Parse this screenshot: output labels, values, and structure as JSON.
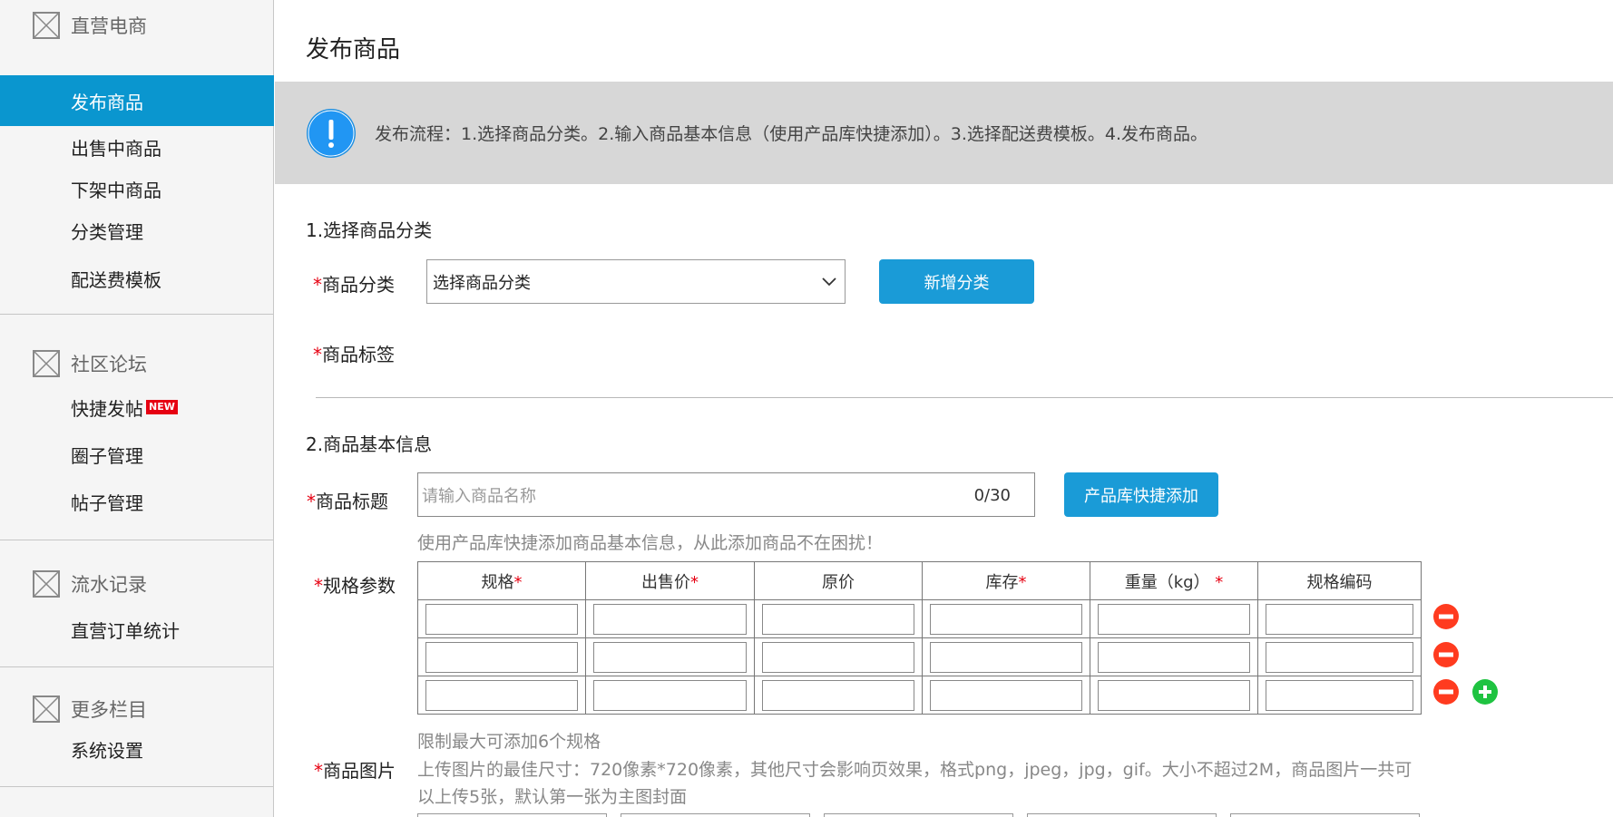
{
  "sidebar": {
    "groups": [
      {
        "title": "直营电商",
        "items": [
          {
            "label": "发布商品",
            "active": true
          },
          {
            "label": "出售中商品"
          },
          {
            "label": "下架中商品"
          },
          {
            "label": "分类管理"
          },
          {
            "label": "配送费模板"
          }
        ]
      },
      {
        "title": "社区论坛",
        "items": [
          {
            "label": "快捷发帖",
            "badge": "NEW"
          },
          {
            "label": "圈子管理"
          },
          {
            "label": "帖子管理"
          }
        ]
      },
      {
        "title": "流水记录",
        "items": [
          {
            "label": "直营订单统计"
          }
        ]
      },
      {
        "title": "更多栏目",
        "items": [
          {
            "label": "系统设置"
          }
        ]
      }
    ]
  },
  "page": {
    "title": "发布商品",
    "notice": "发布流程：1.选择商品分类。2.输入商品基本信息（使用产品库快捷添加）。3.选择配送费模板。4.发布商品。"
  },
  "section1": {
    "title": "1.选择商品分类",
    "category_label": "商品分类",
    "category_value": "选择商品分类",
    "add_category_button": "新增分类",
    "tag_label": "商品标签"
  },
  "section2": {
    "title": "2.商品基本信息",
    "product_title_label": "商品标题",
    "product_title_placeholder": "请输入商品名称",
    "product_title_count": "0/30",
    "quick_add_button": "产品库快捷添加",
    "quick_add_hint": "使用产品库快捷添加商品基本信息，从此添加商品不在困扰！",
    "spec_label": "规格参数",
    "spec_columns": [
      {
        "label": "规格",
        "required": true
      },
      {
        "label": "出售价",
        "required": true
      },
      {
        "label": "原价",
        "required": false
      },
      {
        "label": "库存",
        "required": true
      },
      {
        "label": "重量（kg）",
        "required": true
      },
      {
        "label": "规格编码",
        "required": false
      }
    ],
    "spec_row_count": 3,
    "spec_limit_hint": "限制最大可添加6个规格",
    "image_label": "商品图片",
    "image_hint_line1": "上传图片的最佳尺寸：720像素*720像素，其他尺寸会影响页效果，格式png，jpeg，jpg，gif。大小不超过2M，商品图片一共可",
    "image_hint_line2": "以上传5张，默认第一张为主图封面"
  },
  "colors": {
    "accent": "#0a96cf",
    "button": "#1a9bd7",
    "required": "#e60012",
    "remove": "#ff3b1f",
    "add": "#1fc341"
  }
}
